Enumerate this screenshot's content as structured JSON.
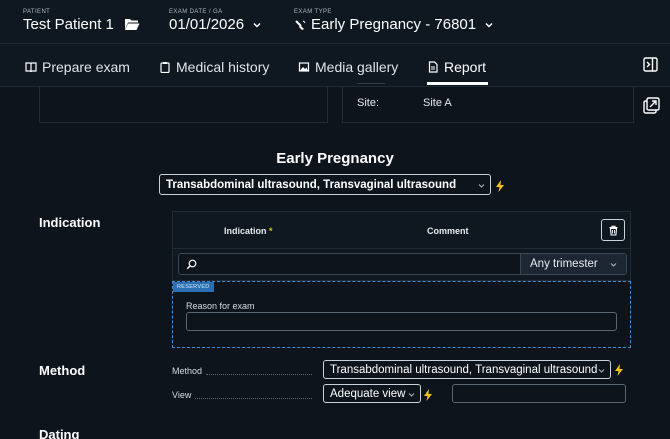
{
  "header": {
    "patient_label": "PATIENT",
    "patient_name": "Test Patient 1",
    "exam_date_label": "EXAM DATE / GA",
    "exam_date": "01/01/2026",
    "exam_type_label": "EXAM TYPE",
    "exam_type": "Early Pregnancy - 76801"
  },
  "nav": {
    "tabs": [
      {
        "label": "Prepare exam",
        "icon": "book-icon"
      },
      {
        "label": "Medical history",
        "icon": "clipboard-icon"
      },
      {
        "label": "Media gallery",
        "icon": "image-icon"
      },
      {
        "label": "Report",
        "icon": "document-icon",
        "active": true
      }
    ]
  },
  "site_card": {
    "site_label": "Site:",
    "site_value": "Site A"
  },
  "report": {
    "title": "Early Pregnancy",
    "exam_modality": "Transabdominal ultrasound, Transvaginal ultrasound"
  },
  "indication": {
    "section_title": "Indication",
    "col_indication": "Indication",
    "required_mark": "*",
    "col_comment": "Comment",
    "search_placeholder": "",
    "trimester_select": "Any trimester",
    "reserved_tag": "RESERVED",
    "reason_label": "Reason for exam",
    "reason_value": ""
  },
  "method": {
    "section_title": "Method",
    "method_label": "Method",
    "method_value": "Transabdominal ultrasound, Transvaginal ultrasound",
    "view_label": "View",
    "view_value": "Adequate view",
    "view_comment": ""
  },
  "dating": {
    "section_title": "Dating"
  },
  "colors": {
    "background": "#0d141c",
    "accent_bolt": "#f2c418",
    "reserved_blue": "#2a6fb3",
    "required_yellow": "#e6c700"
  }
}
